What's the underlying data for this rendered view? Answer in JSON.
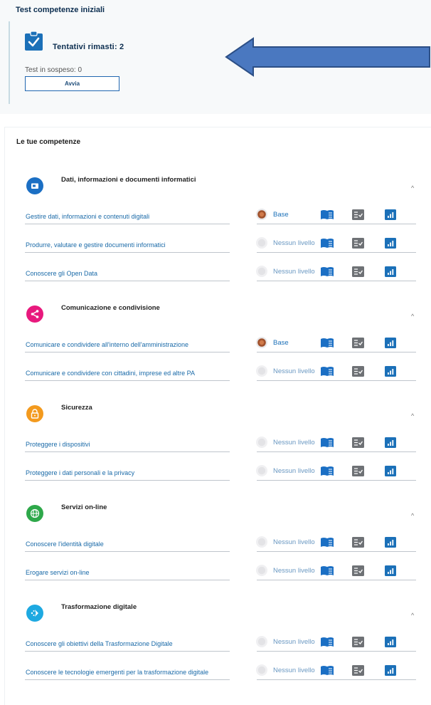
{
  "test": {
    "title": "Test competenze iniziali",
    "attempts": "Tentativi rimasti: 2",
    "pending": "Test in sospeso: 0",
    "start_label": "Avvia"
  },
  "competences": {
    "title": "Le tue competenze",
    "sections": [
      {
        "name": "Dati, informazioni e documenti informatici",
        "icon": "folder-icon",
        "color": "#1b6fc4",
        "items": [
          {
            "name": "Gestire dati, informazioni e contenuti digitali",
            "level": "Base"
          },
          {
            "name": "Produrre, valutare e gestire documenti informatici",
            "level": "Nessun livello"
          },
          {
            "name": "Conoscere gli Open Data",
            "level": "Nessun livello"
          }
        ]
      },
      {
        "name": "Comunicazione e condivisione",
        "icon": "share-icon",
        "color": "#e8197d",
        "items": [
          {
            "name": "Comunicare e condividere all'interno dell'amministrazione",
            "level": "Base"
          },
          {
            "name": "Comunicare e condividere con cittadini, imprese ed altre PA",
            "level": "Nessun livello"
          }
        ]
      },
      {
        "name": "Sicurezza",
        "icon": "lock-icon",
        "color": "#f39a1e",
        "items": [
          {
            "name": "Proteggere i dispositivi",
            "level": "Nessun livello"
          },
          {
            "name": "Proteggere i dati personali e la privacy",
            "level": "Nessun livello"
          }
        ]
      },
      {
        "name": "Servizi on-line",
        "icon": "globe-icon",
        "color": "#2ea84a",
        "items": [
          {
            "name": "Conoscere l'identità digitale",
            "level": "Nessun livello"
          },
          {
            "name": "Erogare servizi on-line",
            "level": "Nessun livello"
          }
        ]
      },
      {
        "name": "Trasformazione digitale",
        "icon": "transform-icon",
        "color": "#1ea9e1",
        "items": [
          {
            "name": "Conoscere gli obiettivi della Trasformazione Digitale",
            "level": "Nessun livello"
          },
          {
            "name": "Conoscere le tecnologie emergenti per la trasformazione digitale",
            "level": "Nessun livello"
          }
        ]
      }
    ]
  },
  "colors": {
    "accent": "#1b70b8",
    "arrow_fill": "#4a78c0",
    "arrow_stroke": "#2c4f86",
    "medal_bronze": "#a0522d"
  }
}
